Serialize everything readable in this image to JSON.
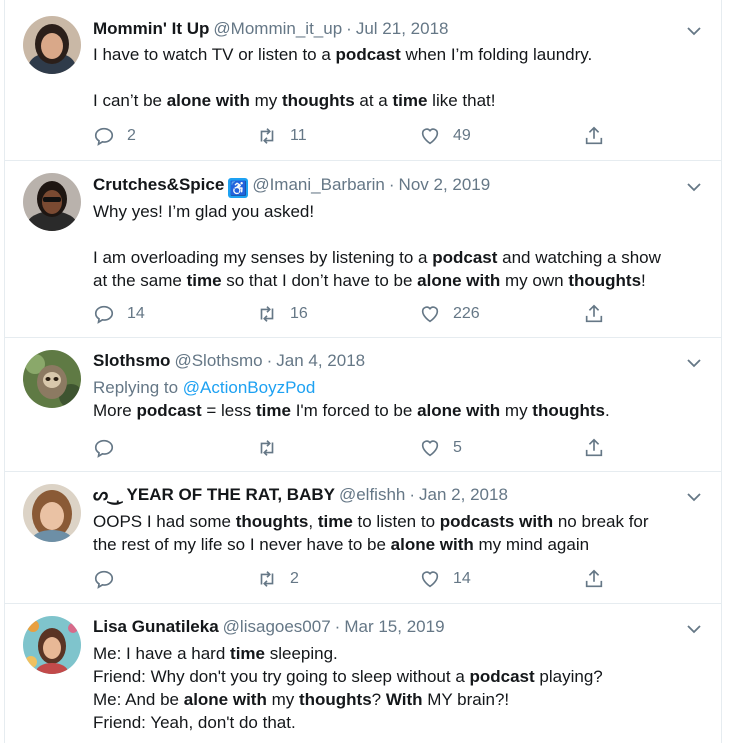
{
  "tweets": [
    {
      "name": "Mommin' It Up",
      "handle": "@Mommin_it_up",
      "sep": "·",
      "date": "Jul 21, 2018",
      "lines": [
        [
          {
            "t": "I have to watch TV or listen to a "
          },
          {
            "t": "podcast",
            "b": true
          },
          {
            "t": " when I’m folding laundry."
          }
        ],
        [],
        [
          {
            "t": "I can’t be "
          },
          {
            "t": "alone with",
            "b": true
          },
          {
            "t": " my "
          },
          {
            "t": "thoughts",
            "b": true
          },
          {
            "t": " at a "
          },
          {
            "t": "time",
            "b": true
          },
          {
            "t": " like that!"
          }
        ]
      ],
      "replies": "2",
      "retweets": "11",
      "likes": "49"
    },
    {
      "name": "Crutches&Spice",
      "badge": "♿",
      "handle": "@Imani_Barbarin",
      "sep": "·",
      "date": "Nov 2, 2019",
      "lines": [
        [
          {
            "t": "Why yes! I’m glad you asked!"
          }
        ],
        [],
        [
          {
            "t": "I am overloading my senses by listening to a "
          },
          {
            "t": "podcast",
            "b": true
          },
          {
            "t": " and watching a show"
          }
        ],
        [
          {
            "t": "at the same "
          },
          {
            "t": "time",
            "b": true
          },
          {
            "t": " so that I don’t have to be "
          },
          {
            "t": "alone with",
            "b": true
          },
          {
            "t": " my own "
          },
          {
            "t": "thoughts",
            "b": true
          },
          {
            "t": "!"
          }
        ]
      ],
      "replies": "14",
      "retweets": "16",
      "likes": "226"
    },
    {
      "name": "Slothsmo",
      "handle": "@Slothsmo",
      "sep": "·",
      "date": "Jan 4, 2018",
      "replying_label": "Replying to ",
      "replying_to": "@ActionBoyzPod",
      "lines": [
        [
          {
            "t": "More "
          },
          {
            "t": "podcast",
            "b": true
          },
          {
            "t": " = less "
          },
          {
            "t": "time",
            "b": true
          },
          {
            "t": " I'm forced to be "
          },
          {
            "t": "alone with",
            "b": true
          },
          {
            "t": " my "
          },
          {
            "t": "thoughts",
            "b": true
          },
          {
            "t": "."
          }
        ]
      ],
      "replies": "",
      "retweets": "",
      "likes": "5"
    },
    {
      "name": "ᔕ‿ͅ YEAR OF THE RAT, BABY",
      "handle": "@elfishh",
      "sep": "·",
      "date": "Jan 2, 2018",
      "lines": [
        [
          {
            "t": "OOPS I had some "
          },
          {
            "t": "thoughts",
            "b": true
          },
          {
            "t": ", "
          },
          {
            "t": "time",
            "b": true
          },
          {
            "t": " to listen to "
          },
          {
            "t": "podcasts with",
            "b": true
          },
          {
            "t": " no break for"
          }
        ],
        [
          {
            "t": "the rest of my life so I never have to be "
          },
          {
            "t": "alone with",
            "b": true
          },
          {
            "t": " my mind again"
          }
        ]
      ],
      "replies": "",
      "retweets": "2",
      "likes": "14"
    },
    {
      "name": "Lisa Gunatileka",
      "handle": "@lisagoes007",
      "sep": "·",
      "date": "Mar 15, 2019",
      "lines": [
        [
          {
            "t": "Me: I have a hard "
          },
          {
            "t": "time",
            "b": true
          },
          {
            "t": " sleeping."
          }
        ],
        [
          {
            "t": "Friend: Why don't you try going to sleep without a "
          },
          {
            "t": "podcast",
            "b": true
          },
          {
            "t": " playing?"
          }
        ],
        [
          {
            "t": "Me: And be "
          },
          {
            "t": "alone with",
            "b": true
          },
          {
            "t": " my "
          },
          {
            "t": "thoughts",
            "b": true
          },
          {
            "t": "? "
          },
          {
            "t": "With",
            "b": true
          },
          {
            "t": " MY brain?!"
          }
        ],
        [
          {
            "t": "Friend: Yeah, don't do that."
          }
        ]
      ],
      "replies": "",
      "retweets": "",
      "likes": ""
    }
  ],
  "icons": {
    "reply": "reply-icon",
    "retweet": "retweet-icon",
    "like": "heart-icon",
    "share": "share-icon",
    "more": "chevron-down-icon"
  },
  "colors": {
    "link": "#1da1f2",
    "secondary_text": "#657786",
    "border": "#e6ecf0",
    "text": "#14171a"
  }
}
